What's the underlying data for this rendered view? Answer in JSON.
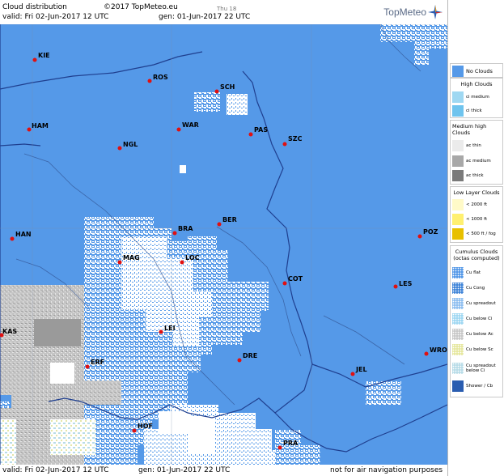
{
  "header": {
    "title": "Cloud distribution",
    "copyright": "©2017 TopMeteo.eu",
    "day": "Thu 18",
    "valid": "valid:  Fri   02-Jun-2017  12 UTC",
    "gen": "gen:  01-Jun-2017 22 UTC",
    "brand": "TopMeteo"
  },
  "footer": {
    "valid": "valid:  Fri   02-Jun-2017  12 UTC",
    "gen": "gen:  01-Jun-2017 22 UTC",
    "disclaimer": "not for air navigation purposes"
  },
  "cities": [
    {
      "name": "KIE"
    },
    {
      "name": "ROS"
    },
    {
      "name": "SCH"
    },
    {
      "name": "HAM"
    },
    {
      "name": "WAR"
    },
    {
      "name": "PAS"
    },
    {
      "name": "SZC"
    },
    {
      "name": "NGL"
    },
    {
      "name": "HAN"
    },
    {
      "name": "BRA"
    },
    {
      "name": "BER"
    },
    {
      "name": "POZ"
    },
    {
      "name": "MAG"
    },
    {
      "name": "LOC"
    },
    {
      "name": "COT"
    },
    {
      "name": "LES"
    },
    {
      "name": "KAS"
    },
    {
      "name": "LEI"
    },
    {
      "name": "ERF"
    },
    {
      "name": "DRE"
    },
    {
      "name": "JEL"
    },
    {
      "name": "WRO"
    },
    {
      "name": "HOF"
    },
    {
      "name": "PRA"
    }
  ],
  "colors": {
    "clear": "#5599e8",
    "cumulus": "#ffffff",
    "stratus": "#b8b8b8",
    "city": "#e01010",
    "border": "#1f3f8f",
    "ci_medium": "#9fd8f2",
    "ci_thick": "#6fc4ee",
    "ac_thin": "#ebebeb",
    "ac_medium": "#a8a8a8",
    "ac_thick": "#7a7a7a",
    "low_2000": "#fffac8",
    "low_1000": "#fff070",
    "low_500": "#e8c000"
  },
  "legend": {
    "no_clouds": "No Clouds",
    "high_title": "High Clouds",
    "high": [
      "ci medium",
      "ci thick"
    ],
    "medium_title": "Medium high Clouds",
    "medium": [
      "ac thin",
      "ac medium",
      "ac thick"
    ],
    "low_title": "Low Layer Clouds",
    "low": [
      "< 2000 ft",
      "< 1000 ft",
      "< 500 ft / fog"
    ],
    "cu_title": "Cumulus Clouds (octas computed)",
    "cu": [
      "Cu flat",
      "Cu Cong",
      "Cu spreadout",
      "Cu below Ci",
      "Cu below Ac",
      "Cu below Sc",
      "Cu spreadout below Ci",
      "Shower / Cb"
    ]
  }
}
